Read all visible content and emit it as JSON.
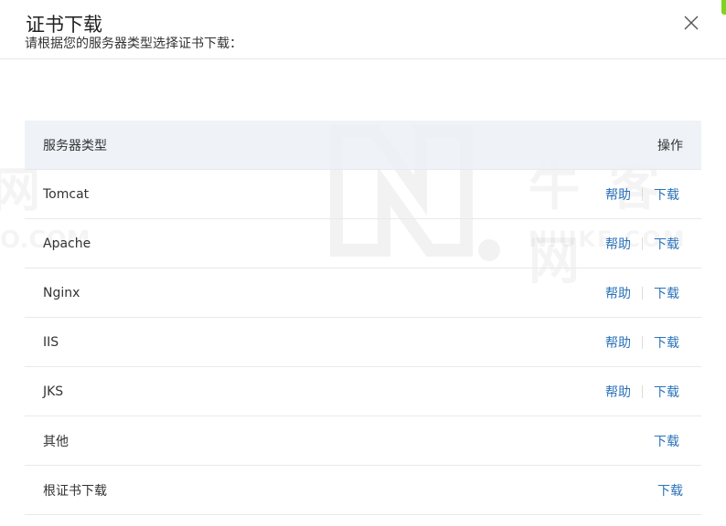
{
  "dialog": {
    "title": "证书下载",
    "instruction": "请根据您的服务器类型选择证书下载："
  },
  "watermark": {
    "left_text": "网",
    "left_sub": "O.COM",
    "right_text": "牛 客 网",
    "right_sub": "NIUKE.COM"
  },
  "table": {
    "header": {
      "type_label": "服务器类型",
      "ops_label": "操作"
    },
    "rows": [
      {
        "name": "Tomcat",
        "help": "帮助",
        "download": "下载"
      },
      {
        "name": "Apache",
        "help": "帮助",
        "download": "下载"
      },
      {
        "name": "Nginx",
        "help": "帮助",
        "download": "下载"
      },
      {
        "name": "IIS",
        "help": "帮助",
        "download": "下载"
      },
      {
        "name": "JKS",
        "help": "帮助",
        "download": "下载"
      },
      {
        "name": "其他",
        "download": "下载"
      },
      {
        "name": "根证书下载",
        "download": "下载"
      }
    ]
  },
  "colors": {
    "link": "#2a72b8",
    "header_bg": "#ecf1f7",
    "border": "#e6e9ee",
    "scroll_accent": "#7ed321"
  }
}
